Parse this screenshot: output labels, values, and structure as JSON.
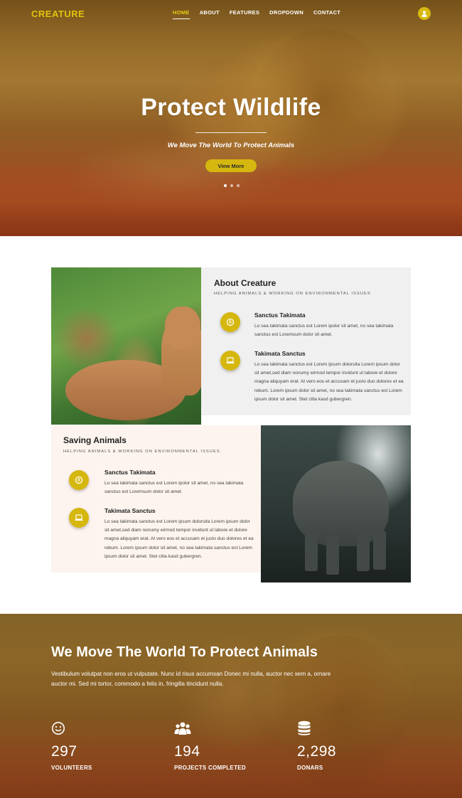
{
  "nav": {
    "logo": "CREATURE",
    "items": [
      {
        "label": "HOME"
      },
      {
        "label": "ABOUT"
      },
      {
        "label": "FEATURES"
      },
      {
        "label": "DROPDOWN"
      },
      {
        "label": "CONTACT"
      }
    ],
    "active_index": 0
  },
  "hero": {
    "title": "Protect Wildlife",
    "subtitle": "We Move The World To Protect Animals",
    "button": "View More",
    "slides": 3,
    "active_slide": 0
  },
  "about": {
    "title": "About Creature",
    "subtitle": "HELPING ANIMALS & WORKING ON ENVIRONMENTAL ISSUES",
    "features": [
      {
        "icon": "recycle-icon",
        "title": "Sanctus Takimata",
        "text": "Lo sea takimata sanctus est Lorem ipolor sit amet, no sea takimata sanctus est Loremsum dolor sit amet."
      },
      {
        "icon": "laptop-icon",
        "title": "Takimata Sanctus",
        "text": "Lo sea takimata sanctus est Lorem ipsum dolorsita Lorem ipsum dolor sit amet,sed diam nonumy eirmod tempor invidunt ut labore et dolore magna aliquyam erat. At vero eos et accusam et justo duo dolores et ea rebum. Lorem ipsum dolor sit amet, no sea takimata sanctus est Lorem ipsum dolor sit amet. Stet clita kasd gubergren."
      }
    ]
  },
  "saving": {
    "title": "Saving Animals",
    "subtitle": "HELPING ANIMALS & WORKING ON ENVIRONMENTAL ISSUES.",
    "features": [
      {
        "icon": "recycle-icon",
        "title": "Sanctus Takimata",
        "text": "Lo sea takimata sanctus est Lorem ipolor sit amet, no sea takimata sanctus est Loremsum dolor sit amet."
      },
      {
        "icon": "laptop-icon",
        "title": "Takimata Sanctus",
        "text": "Lo sea takimata sanctus est Lorem ipsum dolorsita Lorem ipsum dolor sit amet,sed diam nonumy eirmod tempor invidunt ut labore et dolore magna aliquyam erat. At vero eos et accusam et justo duo dolores et ea rebum. Lorem ipsum dolor sit amet, no sea takimata sanctus est Lorem ipsum dolor sit amet. Stet clita kasd gubergren."
      }
    ]
  },
  "mission": {
    "title": "We Move The World To Protect Animals",
    "text": "Vestibulum volutpat non eros ut vulputate. Nunc id risus accumsan Donec mi nulla, auctor nec sem a, ornare auctor mi. Sed mi tortor, commodo a felis in, fringilla tincidunt nulla.",
    "stats": [
      {
        "icon": "smiley-icon",
        "value": "297",
        "label": "VOLUNTEERS"
      },
      {
        "icon": "users-icon",
        "value": "194",
        "label": "PROJECTS COMPLETED"
      },
      {
        "icon": "database-icon",
        "value": "2,298",
        "label": "DONARS"
      }
    ]
  },
  "colors": {
    "accent": "#d6b70e",
    "logo": "#e3c20c",
    "about_panel_bg": "#f0f0f0",
    "saving_panel_bg": "#fdf4ef"
  }
}
